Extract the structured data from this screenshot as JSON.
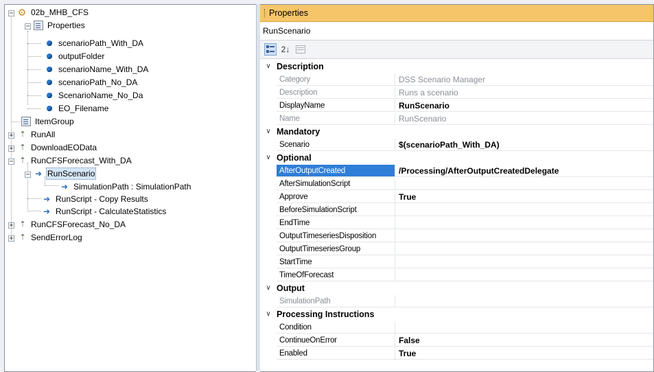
{
  "tree": {
    "root": "02b_MHB_CFS",
    "properties": {
      "label": "Properties",
      "children": [
        "scenarioPath_With_DA",
        "outputFolder",
        "scenarioName_With_DA",
        "scenarioPath_No_DA",
        "ScenarioName_No_Da",
        "EO_Filename"
      ]
    },
    "item_group": "ItemGroup",
    "run_all": "RunAll",
    "download_eo": "DownloadEOData",
    "run_with_da": "RunCFSForecast_With_DA",
    "run_scenario": "RunScenario",
    "simulation_path": "SimulationPath : SimulationPath",
    "copy_results": "RunScript - Copy Results",
    "calc_stats": "RunScript - CalculateStatistics",
    "run_no_da": "RunCFSForecast_No_DA",
    "send_error": "SendErrorLog",
    "expander_plus": "+",
    "expander_minus": "−"
  },
  "props": {
    "title": "Properties",
    "object": "RunScenario",
    "toolbar": {
      "categorized_icon": "categorized-icon",
      "alpha_icon": "alphabetical-sort-icon",
      "alpha_glyph": "2↓",
      "pages_icon": "property-pages-icon"
    },
    "chevron": "∨",
    "categories": [
      {
        "name": "Description",
        "rows": [
          {
            "name": "Category",
            "value": "DSS Scenario Manager",
            "dim": true
          },
          {
            "name": "Description",
            "value": "Runs a scenario",
            "dim": true
          },
          {
            "name": "DisplayName",
            "value": "RunScenario",
            "bold": true
          },
          {
            "name": "Name",
            "value": "RunScenario",
            "dim": true
          }
        ]
      },
      {
        "name": "Mandatory",
        "rows": [
          {
            "name": "Scenario",
            "value": "$(scenarioPath_With_DA)",
            "bold": true
          }
        ]
      },
      {
        "name": "Optional",
        "rows": [
          {
            "name": "AfterOutputCreated",
            "value": "/Processing/AfterOutputCreatedDelegate",
            "bold": true,
            "selected": true
          },
          {
            "name": "AfterSimulationScript",
            "value": ""
          },
          {
            "name": "Approve",
            "value": "True",
            "bold": true
          },
          {
            "name": "BeforeSimulationScript",
            "value": ""
          },
          {
            "name": "EndTime",
            "value": ""
          },
          {
            "name": "OutputTimeseriesDisposition",
            "value": ""
          },
          {
            "name": "OutputTimeseriesGroup",
            "value": ""
          },
          {
            "name": "StartTime",
            "value": ""
          },
          {
            "name": "TimeOfForecast",
            "value": ""
          }
        ]
      },
      {
        "name": "Output",
        "rows": [
          {
            "name": "SimulationPath",
            "value": "",
            "dim": true
          }
        ]
      },
      {
        "name": "Processing Instructions",
        "rows": [
          {
            "name": "Condition",
            "value": ""
          },
          {
            "name": "ContinueOnError",
            "value": "False",
            "bold": true
          },
          {
            "name": "Enabled",
            "value": "True",
            "bold": true
          }
        ]
      }
    ],
    "colors": {
      "header": "#f6c56a",
      "selected": "#2f7ed8"
    }
  }
}
